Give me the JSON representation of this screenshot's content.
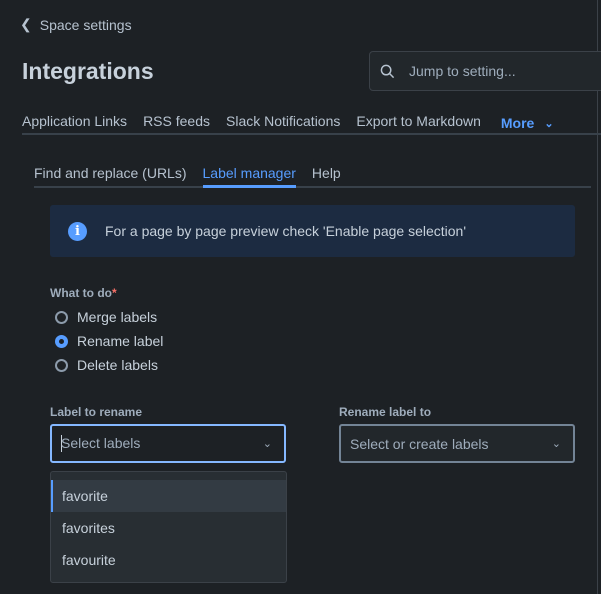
{
  "back_link": "Space settings",
  "page_title": "Integrations",
  "search": {
    "placeholder": "Jump to setting..."
  },
  "tabs": [
    "Application Links",
    "RSS feeds",
    "Slack Notifications",
    "Export to Markdown"
  ],
  "more_label": "More",
  "subtabs": [
    "Find and replace (URLs)",
    "Label manager",
    "Help"
  ],
  "info": "For a page by page preview check 'Enable page selection'",
  "form": {
    "what_label": "What to do",
    "required": "*",
    "options": [
      "Merge labels",
      "Rename label",
      "Delete labels"
    ],
    "selected": "Rename label",
    "from_label": "Label to rename",
    "from_placeholder": "Select labels",
    "to_label": "Rename label to",
    "to_placeholder": "Select or create labels"
  },
  "dropdown": [
    "favorite",
    "favorites",
    "favourite"
  ],
  "colors": {
    "accent": "#579dff",
    "bg": "#1d2125",
    "info_bg": "#1c2b41"
  }
}
